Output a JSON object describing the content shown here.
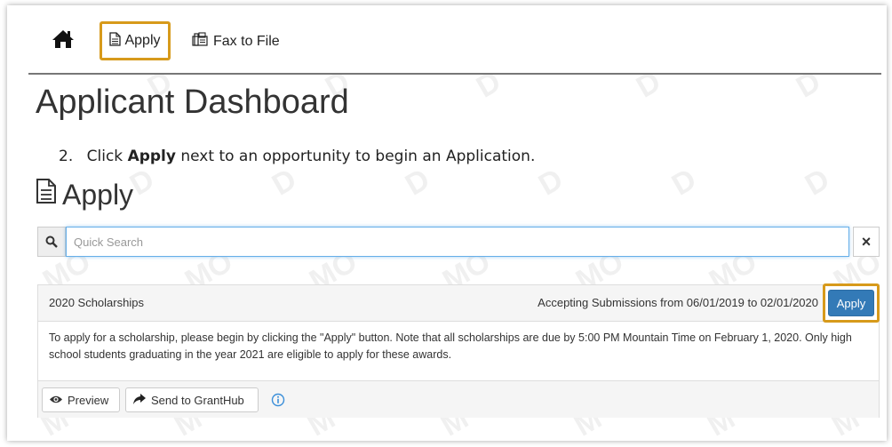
{
  "nav": {
    "home_icon": "home-icon",
    "apply_label": "Apply",
    "apply_icon": "document-icon",
    "fax_label": "Fax to File",
    "fax_icon": "fax-icon",
    "highlight_color": "#d79a1b"
  },
  "page": {
    "title": "Applicant Dashboard"
  },
  "instruction": {
    "number": "2.",
    "prefix": "Click",
    "bold": "Apply",
    "suffix": "next to an opportunity to begin an Application."
  },
  "section": {
    "title": "Apply",
    "icon": "document-icon"
  },
  "search": {
    "icon": "search-icon",
    "placeholder": "Quick Search",
    "value": "",
    "clear_label": "×"
  },
  "opportunity": {
    "name": "2020 Scholarships",
    "dates": "Accepting Submissions from 06/01/2019 to 02/01/2020",
    "apply_label": "Apply",
    "apply_color": "#337ab7",
    "description": "To apply for a scholarship, please begin by clicking the \"Apply\" button. Note that all scholarships are due by 5:00 PM Mountain Time on February 1, 2020. Only high school students graduating in the year 2021 are eligible to apply for these awards.",
    "preview_label": "Preview",
    "preview_icon": "eye-icon",
    "grant_label": "Send to GrantHub",
    "grant_icon": "share-arrow-icon",
    "info_icon": "info-icon"
  }
}
